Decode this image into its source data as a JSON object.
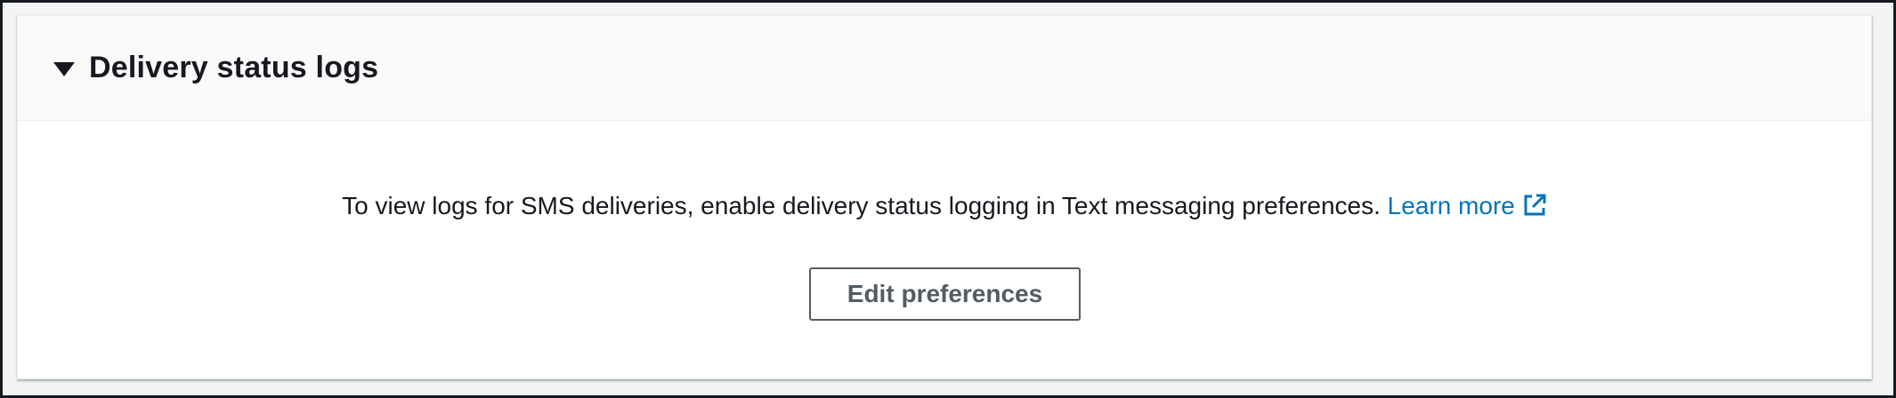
{
  "panel": {
    "title": "Delivery status logs",
    "expanded": true,
    "caret_icon": "caret-down-icon"
  },
  "body": {
    "message": "To view logs for SMS deliveries, enable delivery status logging in Text messaging preferences.",
    "learn_more_label": "Learn more",
    "external_icon": "external-link-icon",
    "edit_button_label": "Edit preferences"
  },
  "colors": {
    "link": "#0073bb",
    "text": "#16191f",
    "button_border": "#545b64",
    "header_bg": "#fafafa"
  }
}
